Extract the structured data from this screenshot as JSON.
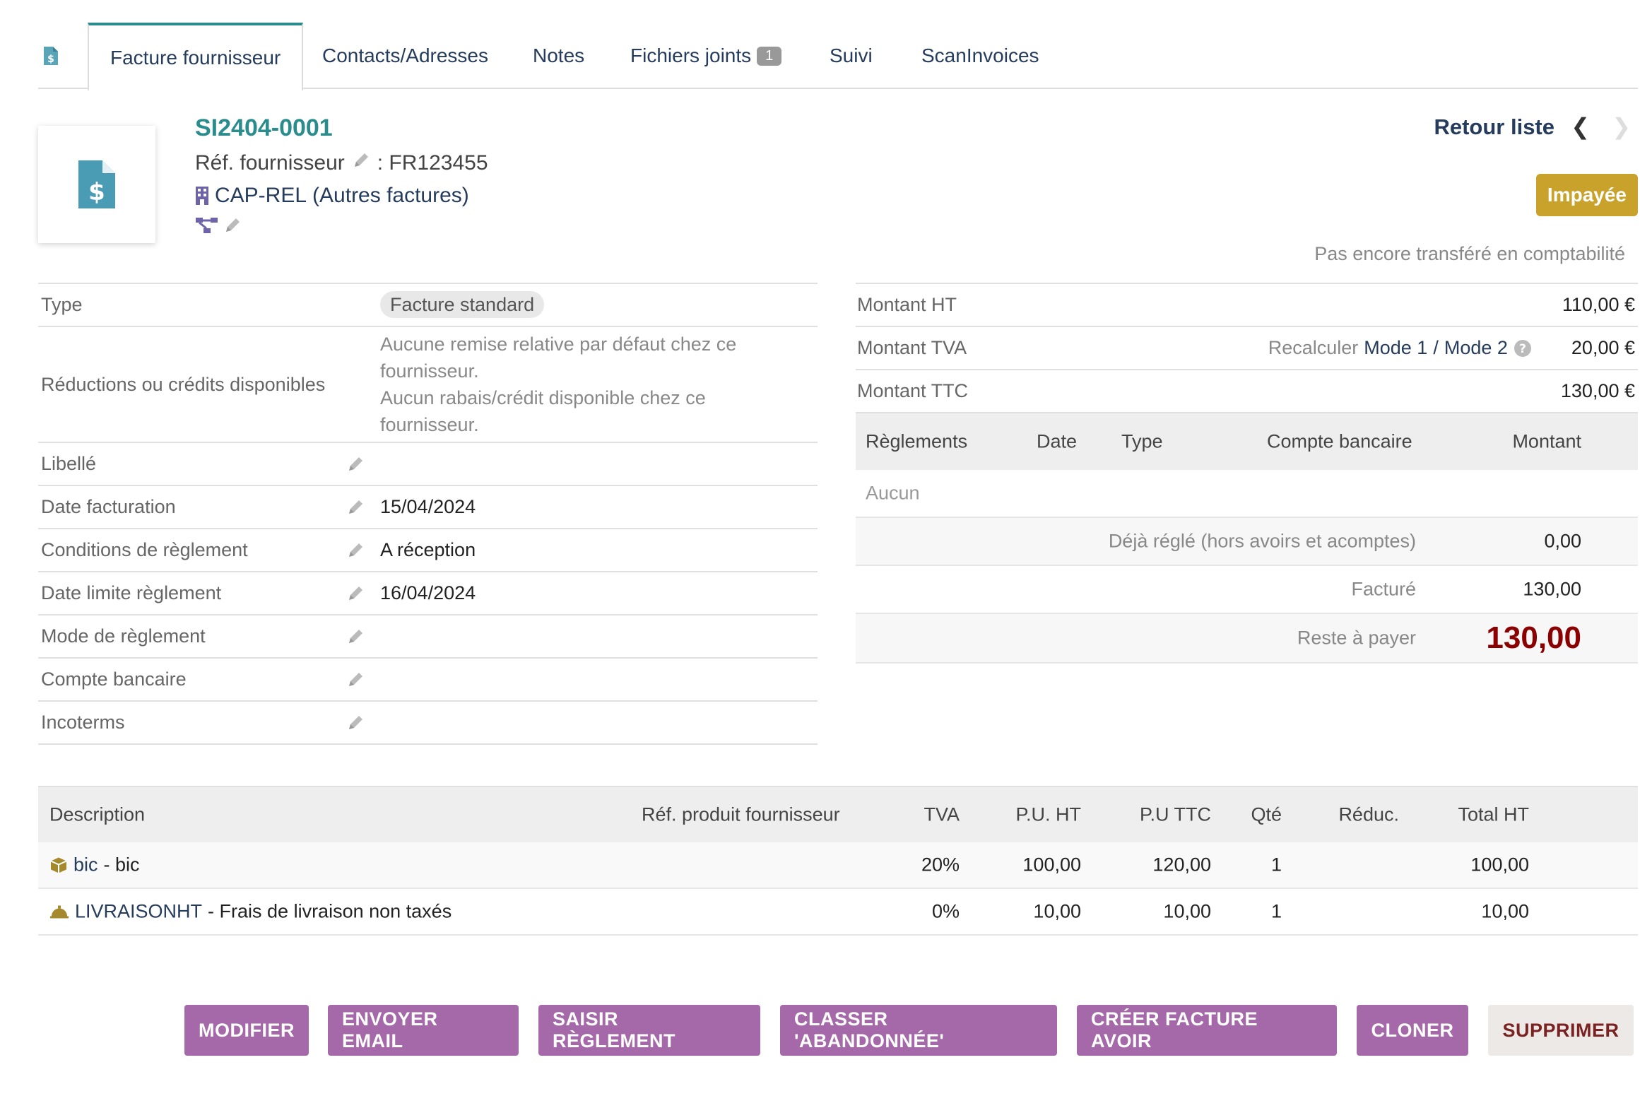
{
  "tabs": [
    {
      "label": "Facture fournisseur"
    },
    {
      "label": "Contacts/Adresses"
    },
    {
      "label": "Notes"
    },
    {
      "label": "Fichiers joints",
      "badge": "1"
    },
    {
      "label": "Suivi"
    },
    {
      "label": "ScanInvoices"
    }
  ],
  "header": {
    "ref": "SI2404-0001",
    "supplier_ref_label": "Réf. fournisseur",
    "supplier_ref_value": ": FR123455",
    "company_name": "CAP-REL",
    "company_suffix": "(Autres factures)",
    "back_to_list": "Retour liste",
    "status": "Impayée",
    "accounting_status": "Pas encore transféré en comptabilité"
  },
  "fields": {
    "type_label": "Type",
    "type_value": "Facture standard",
    "discounts_label": "Réductions ou crédits disponibles",
    "discounts_line1": "Aucune remise relative par défaut chez ce fournisseur.",
    "discounts_line2": "Aucun rabais/crédit disponible chez ce fournisseur.",
    "label_label": "Libellé",
    "date_label": "Date facturation",
    "date_value": "15/04/2024",
    "conditions_label": "Conditions de règlement",
    "conditions_value": "A réception",
    "due_label": "Date limite règlement",
    "due_value": "16/04/2024",
    "mode_label": "Mode de règlement",
    "bank_label": "Compte bancaire",
    "incoterms_label": "Incoterms"
  },
  "amounts": {
    "ht_label": "Montant HT",
    "ht_value": "110,00 €",
    "tva_label": "Montant TVA",
    "recalc_label": "Recalculer",
    "mode1": "Mode 1",
    "separator": "/",
    "mode2": "Mode 2",
    "tva_value": "20,00 €",
    "ttc_label": "Montant TTC",
    "ttc_value": "130,00 €"
  },
  "payments": {
    "headers": [
      "Règlements",
      "Date",
      "Type",
      "Compte bancaire",
      "Montant"
    ],
    "none": "Aucun",
    "paid_label": "Déjà réglé (hors avoirs et acomptes)",
    "paid_value": "0,00",
    "billed_label": "Facturé",
    "billed_value": "130,00",
    "remaining_label": "Reste à payer",
    "remaining_value": "130,00",
    "remaining_color": "#8b0000"
  },
  "lines": {
    "headers": [
      "Description",
      "Réf. produit fournisseur",
      "TVA",
      "P.U. HT",
      "P.U TTC",
      "Qté",
      "Réduc.",
      "Total HT"
    ],
    "rows": [
      {
        "code": "bic",
        "desc": " - bic",
        "tva": "20%",
        "pu_ht": "100,00",
        "pu_ttc": "120,00",
        "qty": "1",
        "total": "100,00",
        "icon": "product-box-icon"
      },
      {
        "code": "LIVRAISONHT",
        "desc": " - Frais de livraison non taxés",
        "tva": "0%",
        "pu_ht": "10,00",
        "pu_ttc": "10,00",
        "qty": "1",
        "total": "10,00",
        "icon": "service-bell-icon"
      }
    ]
  },
  "actions": {
    "modify": "MODIFIER",
    "send_email": "ENVOYER EMAIL",
    "payment": "SAISIR RÈGLEMENT",
    "abandon": "CLASSER 'ABANDONNÉE'",
    "credit_note": "CRÉER FACTURE AVOIR",
    "clone": "CLONER",
    "delete": "SUPPRIMER"
  },
  "colors": {
    "accent": "#2a8c8c",
    "link": "#263c5c",
    "button": "#a569a9",
    "status": "#c9a22b"
  }
}
